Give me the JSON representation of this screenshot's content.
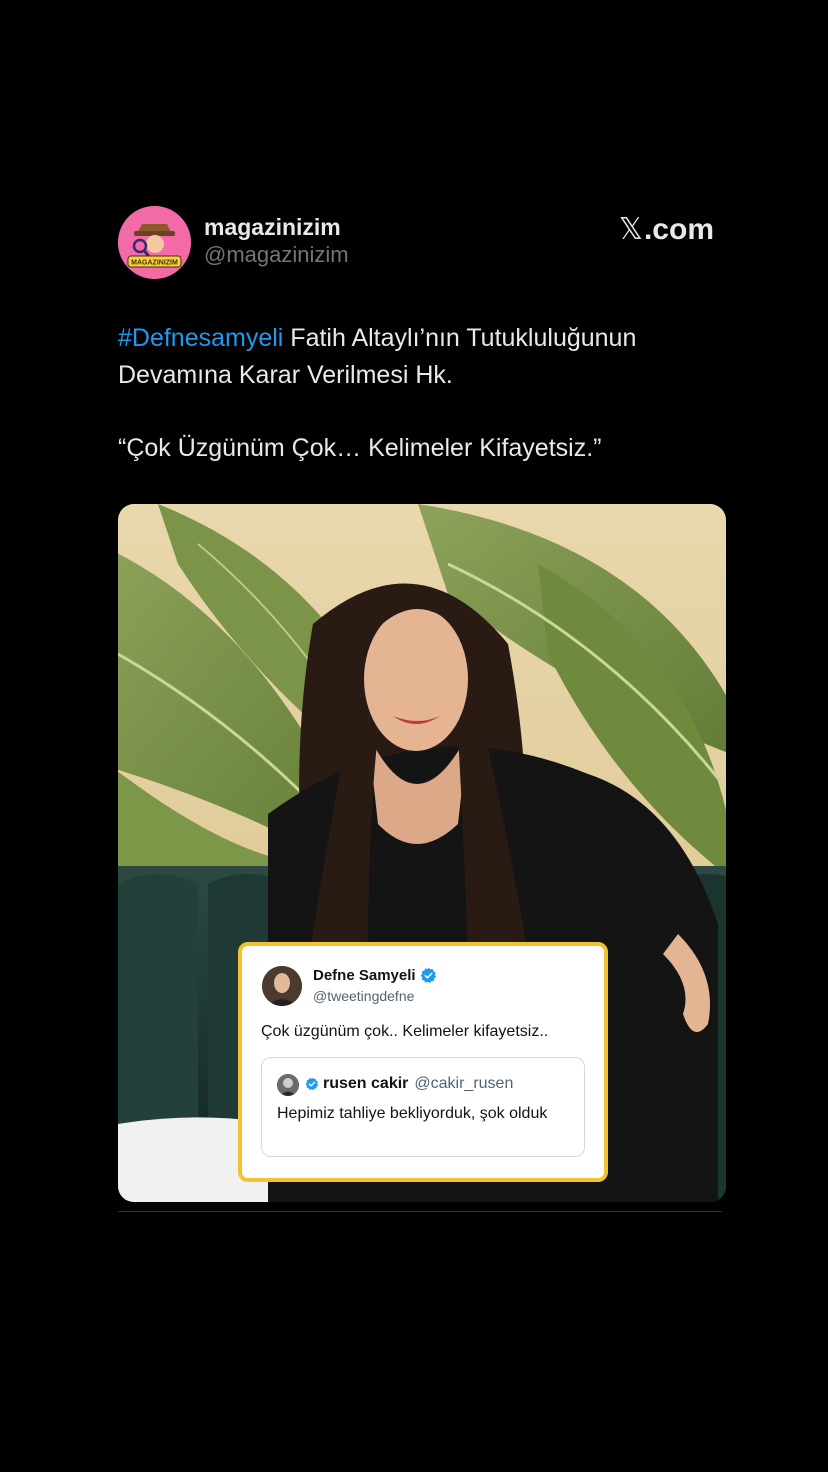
{
  "author": {
    "display_name": "magazinizim",
    "handle": "@magazinizim",
    "avatar_text": "MAGAZINIZIM"
  },
  "brand": {
    "x_glyph": "𝕏",
    "domain": ".com"
  },
  "post": {
    "hashtag": "#Defnesamyeli",
    "text_after_hashtag": " Fatih Altaylı’nın Tutukluluğunun Devamına Karar Verilmesi Hk.",
    "quote": "“Çok Üzgünüm Çok… Kelimeler Kifayetsiz.”"
  },
  "media": {
    "embedded_tweet": {
      "name": "Defne Samyeli",
      "handle": "@tweetingdefne",
      "text": "Çok üzgünüm çok.. Kelimeler kifayetsiz..",
      "quoted": {
        "name": "rusen cakir",
        "handle": "@cakir_rusen",
        "text": "Hepimiz tahliye bekliyorduk, şok olduk"
      }
    }
  },
  "colors": {
    "background": "#000000",
    "hashtag": "#1d9bf0",
    "verified": "#1d9bf0",
    "embed_border": "#f1c232",
    "avatar_bg": "#f26aa8"
  }
}
